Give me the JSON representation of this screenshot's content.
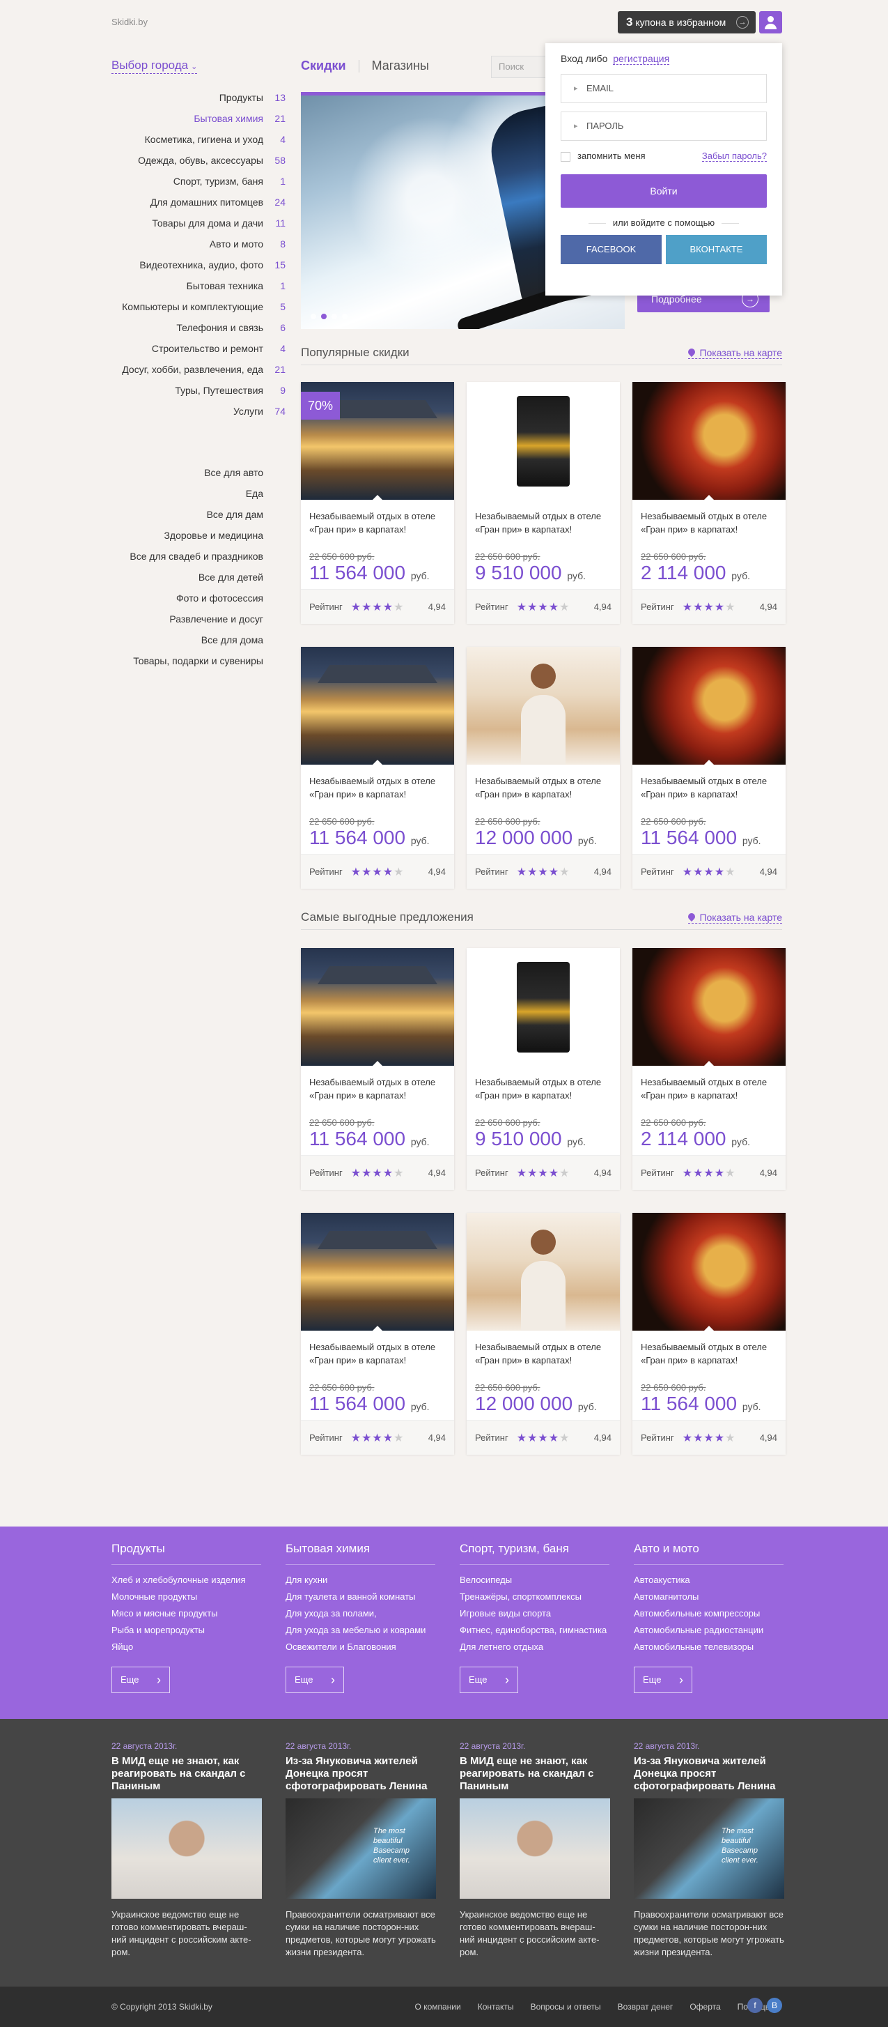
{
  "header": {
    "logo": "Skidki.by",
    "favorites_count": "3",
    "favorites_label": "купона в избранном",
    "favorites_arrow": "→"
  },
  "city_select": {
    "label": "Выбор города",
    "chevron": "⌄"
  },
  "categories": [
    {
      "label": "Продукты",
      "count": "13"
    },
    {
      "label": "Бытовая химия",
      "count": "21",
      "active": true
    },
    {
      "label": "Косметика, гигиена и уход",
      "count": "4"
    },
    {
      "label": "Одежда, обувь, аксессуары",
      "count": "58"
    },
    {
      "label": "Спорт, туризм, баня",
      "count": "1"
    },
    {
      "label": "Для домашних питомцев",
      "count": "24"
    },
    {
      "label": "Товары для дома и дачи",
      "count": "11"
    },
    {
      "label": "Авто и мото",
      "count": "8"
    },
    {
      "label": "Видеотехника, аудио, фото",
      "count": "15"
    },
    {
      "label": "Бытовая техника",
      "count": "1"
    },
    {
      "label": "Компьютеры и комплектующие",
      "count": "5"
    },
    {
      "label": "Телефония и связь",
      "count": "6"
    },
    {
      "label": "Строительство и ремонт",
      "count": "4"
    },
    {
      "label": "Досуг, хобби, развлечения, еда",
      "count": "21"
    },
    {
      "label": "Туры, Путешествия",
      "count": "9"
    },
    {
      "label": "Услуги",
      "count": "74"
    }
  ],
  "general_categories": [
    "Все для авто",
    "Еда",
    "Все для дам",
    "Здоровье и медицина",
    "Все для свадеб и праздников",
    "Все для детей",
    "Фото и фотосессия",
    "Развлечение и досуг",
    "Все для дома",
    "Товары, подарки и сувениры"
  ],
  "tabs": {
    "discounts": "Скидки",
    "shops": "Магазины"
  },
  "search": {
    "placeholder": "Поиск"
  },
  "slider": {
    "more_label": "Подробнее",
    "more_arrow": "→"
  },
  "login": {
    "enter": "Вход",
    "or": "либо",
    "register": "регистрация",
    "email_placeholder": "EMAIL",
    "password_placeholder": "ПАРОЛЬ",
    "remember": "запомнить меня",
    "forgot": "Забыл пароль?",
    "submit": "Войти",
    "social_prompt": "или войдите с помощью",
    "facebook": "FACEBOOK",
    "vkontakte": "ВКОНТАКТЕ"
  },
  "popular": {
    "title": "Популярные скидки",
    "map_link": "Показать на карте"
  },
  "best": {
    "title": "Самые выгодные предложения",
    "map_link": "Показать на карте"
  },
  "card_common": {
    "desc": "Незабываемый отдых в отеле «Гран при» в карпатах!",
    "currency": "руб.",
    "rating_label": "Рейтинг",
    "rating_value": "4,94",
    "stars": "★★★★",
    "star_empty": "★"
  },
  "popular_cards": [
    {
      "image": "house",
      "badge": "70%",
      "old": "22 650 600 руб.",
      "price": "11 564 000"
    },
    {
      "image": "coffee",
      "old": "22 650 600 руб.",
      "price": "9 510 000"
    },
    {
      "image": "pizza",
      "old": "22 650 600 руб.",
      "price": "2 114 000"
    },
    {
      "image": "house",
      "old": "22 650 600 руб.",
      "price": "11 564 000"
    },
    {
      "image": "yoga",
      "old": "22 650 600 руб.",
      "price": "12 000 000"
    },
    {
      "image": "pizza",
      "old": "22 650 600 руб.",
      "price": "11 564 000"
    }
  ],
  "best_cards": [
    {
      "image": "house",
      "old": "22 650 600 руб.",
      "price": "11 564 000"
    },
    {
      "image": "coffee",
      "old": "22 650 600 руб.",
      "price": "9 510 000"
    },
    {
      "image": "pizza",
      "old": "22 650 600 руб.",
      "price": "2 114 000"
    },
    {
      "image": "house",
      "old": "22 650 600 руб.",
      "price": "11 564 000"
    },
    {
      "image": "yoga",
      "old": "22 650 600 руб.",
      "price": "12 000 000"
    },
    {
      "image": "pizza",
      "old": "22 650 600 руб.",
      "price": "11 564 000"
    }
  ],
  "footer_cats": [
    {
      "title": "Продукты",
      "items": [
        "Хлеб и хлебобулочные изделия",
        "Молочные продукты",
        "Мясо и мясные продукты",
        "Рыба и морепродукты",
        "Яйцо"
      ],
      "more": "Еще"
    },
    {
      "title": "Бытовая химия",
      "items": [
        "Для кухни",
        "Для туалета и ванной комнаты",
        "Для ухода за полами,",
        "Для ухода за мебелью и коврами",
        "Освежители и Благовония"
      ],
      "more": "Еще"
    },
    {
      "title": "Спорт, туризм, баня",
      "items": [
        "Велосипеды",
        "Тренажёры, спорткомплексы",
        "Игровые виды спорта",
        "Фитнес, единоборства, гимнастика",
        "Для летнего отдыха"
      ],
      "more": "Еще"
    },
    {
      "title": "Авто и мото",
      "items": [
        "Автоакустика",
        "Автомагнитолы",
        "Автомобильные компрессоры",
        "Автомобильные радиостанции",
        "Автомобильные телевизоры"
      ],
      "more": "Еще"
    }
  ],
  "news": [
    {
      "date": "22 августа 2013г.",
      "title": "В МИД еще не знают, как реагировать на скандал с Паниным",
      "image": "man",
      "text": "Украинское ведомство еще не готово комментировать вчераш-ний инцидент с российским акте-ром."
    },
    {
      "date": "22 августа 2013г.",
      "title": "Из-за Януковича жителей Донецка просят сфотографировать Ленина",
      "image": "jar",
      "image_text": "The most beautiful Basecamp client ever.",
      "text": "Правоохранители осматривают все сумки на наличие посторон-них предметов, которые могут угрожать жизни президента."
    },
    {
      "date": "22 августа 2013г.",
      "title": "В МИД еще не знают, как реагировать на скандал с Паниным",
      "image": "man",
      "text": "Украинское ведомство еще не готово комментировать вчераш-ний инцидент с российским акте-ром."
    },
    {
      "date": "22 августа 2013г.",
      "title": "Из-за Януковича жителей Донецка просят сфотографировать Ленина",
      "image": "jar",
      "image_text": "The most beautiful Basecamp client ever.",
      "text": "Правоохранители осматривают все сумки на наличие посторон-них предметов, которые могут угрожать жизни президента."
    }
  ],
  "bottom": {
    "copyright": "© Copyright 2013 Skidki.by",
    "menu": [
      "О компании",
      "Контакты",
      "Вопросы и ответы",
      "Возврат денег",
      "Оферта",
      "Помощь"
    ],
    "social": [
      "f",
      "B"
    ]
  },
  "colors": {
    "accent": "#8d5ad6",
    "footer": "#9966dd",
    "dark": "#454545",
    "facebook": "#4f69a8",
    "vk": "#4fa0c8"
  }
}
